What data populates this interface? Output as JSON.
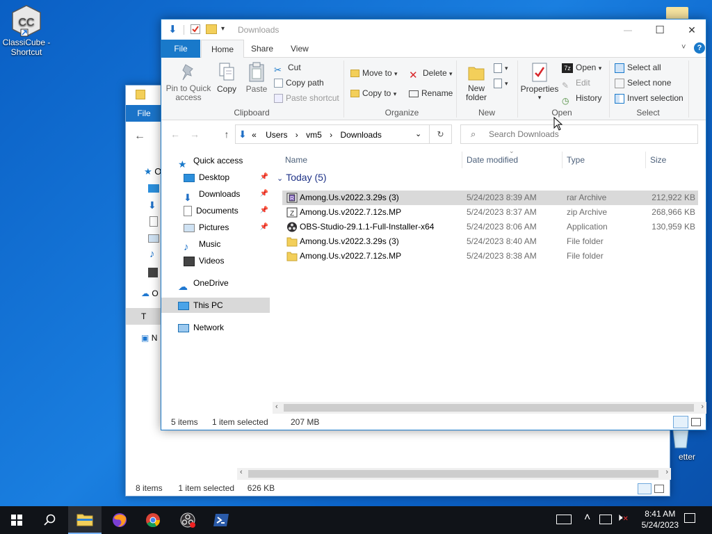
{
  "desktop": {
    "icons": [
      {
        "label": "ClassiCube - Shortcut",
        "icon": "classicube-icon"
      },
      {
        "label": "etter",
        "icon": "recycle-bin-icon"
      }
    ]
  },
  "back_window": {
    "file_tab": "File",
    "nav_partial": [
      "O",
      "O",
      "T",
      "N"
    ],
    "status": {
      "count": "8 items",
      "selection": "1 item selected",
      "size": "626 KB"
    }
  },
  "window": {
    "title": "Downloads",
    "controls": {
      "minimize": "—",
      "maximize": "☐",
      "close": "✕"
    },
    "tabs": {
      "file": "File",
      "home": "Home",
      "share": "Share",
      "view": "View"
    },
    "ribbon": {
      "clipboard": {
        "label": "Clipboard",
        "pin": "Pin to Quick access",
        "copy": "Copy",
        "paste": "Paste",
        "cut": "Cut",
        "copy_path": "Copy path",
        "paste_shortcut": "Paste shortcut"
      },
      "organize": {
        "label": "Organize",
        "move_to": "Move to",
        "copy_to": "Copy to",
        "delete": "Delete",
        "rename": "Rename"
      },
      "new": {
        "label": "New",
        "new_folder": "New folder"
      },
      "open": {
        "label": "Open",
        "properties": "Properties",
        "open": "Open",
        "edit": "Edit",
        "history": "History"
      },
      "select": {
        "label": "Select",
        "select_all": "Select all",
        "select_none": "Select none",
        "invert": "Invert selection"
      }
    },
    "address": {
      "prefix": "«",
      "crumbs": [
        "Users",
        "vm5",
        "Downloads"
      ]
    },
    "search": {
      "placeholder": "Search Downloads"
    },
    "nav": {
      "quick_access": "Quick access",
      "items": [
        {
          "label": "Desktop",
          "icon": "desktop-icon",
          "pinned": true
        },
        {
          "label": "Downloads",
          "icon": "downloads-icon",
          "pinned": true
        },
        {
          "label": "Documents",
          "icon": "documents-icon",
          "pinned": true
        },
        {
          "label": "Pictures",
          "icon": "pictures-icon",
          "pinned": true
        },
        {
          "label": "Music",
          "icon": "music-icon",
          "pinned": false
        },
        {
          "label": "Videos",
          "icon": "videos-icon",
          "pinned": false
        }
      ],
      "onedrive": "OneDrive",
      "this_pc": "This PC",
      "network": "Network"
    },
    "columns": {
      "name": "Name",
      "date": "Date modified",
      "type": "Type",
      "size": "Size"
    },
    "group": {
      "label": "Today (5)"
    },
    "files": [
      {
        "name": "Among.Us.v2022.3.29s (3)",
        "date": "5/24/2023 8:39 AM",
        "type": "rar Archive",
        "size": "212,922 KB",
        "icon": "rar-archive-icon",
        "selected": true
      },
      {
        "name": "Among.Us.v2022.7.12s.MP",
        "date": "5/24/2023 8:37 AM",
        "type": "zip Archive",
        "size": "268,966 KB",
        "icon": "zip-archive-icon",
        "selected": false
      },
      {
        "name": "OBS-Studio-29.1.1-Full-Installer-x64",
        "date": "5/24/2023 8:06 AM",
        "type": "Application",
        "size": "130,959 KB",
        "icon": "obs-app-icon",
        "selected": false
      },
      {
        "name": "Among.Us.v2022.3.29s (3)",
        "date": "5/24/2023 8:40 AM",
        "type": "File folder",
        "size": "",
        "icon": "folder-icon",
        "selected": false
      },
      {
        "name": "Among.Us.v2022.7.12s.MP",
        "date": "5/24/2023 8:38 AM",
        "type": "File folder",
        "size": "",
        "icon": "folder-icon",
        "selected": false
      }
    ],
    "status": {
      "count": "5 items",
      "selection": "1 item selected",
      "size": "207 MB"
    }
  },
  "taskbar": {
    "apps": [
      "start-icon",
      "search-icon",
      "file-explorer-icon",
      "firefox-icon",
      "chrome-icon",
      "obs-icon",
      "powershell-icon"
    ],
    "time": "8:41 AM",
    "date": "5/24/2023"
  }
}
